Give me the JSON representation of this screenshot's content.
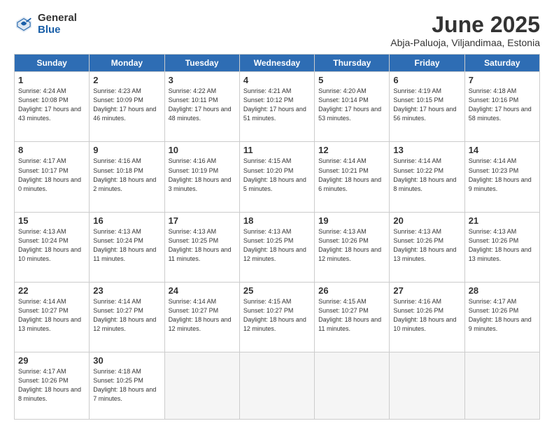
{
  "logo": {
    "general": "General",
    "blue": "Blue"
  },
  "title": "June 2025",
  "subtitle": "Abja-Paluoja, Viljandimaa, Estonia",
  "headers": [
    "Sunday",
    "Monday",
    "Tuesday",
    "Wednesday",
    "Thursday",
    "Friday",
    "Saturday"
  ],
  "weeks": [
    [
      {
        "num": "1",
        "rise": "4:24 AM",
        "set": "10:08 PM",
        "daylight": "17 hours and 43 minutes."
      },
      {
        "num": "2",
        "rise": "4:23 AM",
        "set": "10:09 PM",
        "daylight": "17 hours and 46 minutes."
      },
      {
        "num": "3",
        "rise": "4:22 AM",
        "set": "10:11 PM",
        "daylight": "17 hours and 48 minutes."
      },
      {
        "num": "4",
        "rise": "4:21 AM",
        "set": "10:12 PM",
        "daylight": "17 hours and 51 minutes."
      },
      {
        "num": "5",
        "rise": "4:20 AM",
        "set": "10:14 PM",
        "daylight": "17 hours and 53 minutes."
      },
      {
        "num": "6",
        "rise": "4:19 AM",
        "set": "10:15 PM",
        "daylight": "17 hours and 56 minutes."
      },
      {
        "num": "7",
        "rise": "4:18 AM",
        "set": "10:16 PM",
        "daylight": "17 hours and 58 minutes."
      }
    ],
    [
      {
        "num": "8",
        "rise": "4:17 AM",
        "set": "10:17 PM",
        "daylight": "18 hours and 0 minutes."
      },
      {
        "num": "9",
        "rise": "4:16 AM",
        "set": "10:18 PM",
        "daylight": "18 hours and 2 minutes."
      },
      {
        "num": "10",
        "rise": "4:16 AM",
        "set": "10:19 PM",
        "daylight": "18 hours and 3 minutes."
      },
      {
        "num": "11",
        "rise": "4:15 AM",
        "set": "10:20 PM",
        "daylight": "18 hours and 5 minutes."
      },
      {
        "num": "12",
        "rise": "4:14 AM",
        "set": "10:21 PM",
        "daylight": "18 hours and 6 minutes."
      },
      {
        "num": "13",
        "rise": "4:14 AM",
        "set": "10:22 PM",
        "daylight": "18 hours and 8 minutes."
      },
      {
        "num": "14",
        "rise": "4:14 AM",
        "set": "10:23 PM",
        "daylight": "18 hours and 9 minutes."
      }
    ],
    [
      {
        "num": "15",
        "rise": "4:13 AM",
        "set": "10:24 PM",
        "daylight": "18 hours and 10 minutes."
      },
      {
        "num": "16",
        "rise": "4:13 AM",
        "set": "10:24 PM",
        "daylight": "18 hours and 11 minutes."
      },
      {
        "num": "17",
        "rise": "4:13 AM",
        "set": "10:25 PM",
        "daylight": "18 hours and 11 minutes."
      },
      {
        "num": "18",
        "rise": "4:13 AM",
        "set": "10:25 PM",
        "daylight": "18 hours and 12 minutes."
      },
      {
        "num": "19",
        "rise": "4:13 AM",
        "set": "10:26 PM",
        "daylight": "18 hours and 12 minutes."
      },
      {
        "num": "20",
        "rise": "4:13 AM",
        "set": "10:26 PM",
        "daylight": "18 hours and 13 minutes."
      },
      {
        "num": "21",
        "rise": "4:13 AM",
        "set": "10:26 PM",
        "daylight": "18 hours and 13 minutes."
      }
    ],
    [
      {
        "num": "22",
        "rise": "4:14 AM",
        "set": "10:27 PM",
        "daylight": "18 hours and 13 minutes."
      },
      {
        "num": "23",
        "rise": "4:14 AM",
        "set": "10:27 PM",
        "daylight": "18 hours and 12 minutes."
      },
      {
        "num": "24",
        "rise": "4:14 AM",
        "set": "10:27 PM",
        "daylight": "18 hours and 12 minutes."
      },
      {
        "num": "25",
        "rise": "4:15 AM",
        "set": "10:27 PM",
        "daylight": "18 hours and 12 minutes."
      },
      {
        "num": "26",
        "rise": "4:15 AM",
        "set": "10:27 PM",
        "daylight": "18 hours and 11 minutes."
      },
      {
        "num": "27",
        "rise": "4:16 AM",
        "set": "10:26 PM",
        "daylight": "18 hours and 10 minutes."
      },
      {
        "num": "28",
        "rise": "4:17 AM",
        "set": "10:26 PM",
        "daylight": "18 hours and 9 minutes."
      }
    ],
    [
      {
        "num": "29",
        "rise": "4:17 AM",
        "set": "10:26 PM",
        "daylight": "18 hours and 8 minutes."
      },
      {
        "num": "30",
        "rise": "4:18 AM",
        "set": "10:25 PM",
        "daylight": "18 hours and 7 minutes."
      },
      null,
      null,
      null,
      null,
      null
    ]
  ]
}
